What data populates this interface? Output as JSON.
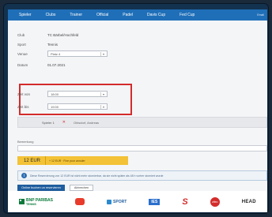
{
  "nav": {
    "tabs": [
      "Spieler",
      "Clubs",
      "Trainer",
      "Official",
      "Padel",
      "Davis Cup",
      "Fed Cup"
    ],
    "right_text": "Email"
  },
  "form": {
    "club": {
      "label": "Club",
      "value": "TC Bärbel/Hochfeld"
    },
    "sport": {
      "label": "Sport",
      "value": "Tennis"
    },
    "venue": {
      "label": "Venue",
      "value": "Platz 4"
    },
    "date": {
      "label": "Datum",
      "value": "01.07.2021"
    },
    "time_from": {
      "label": "Zeit von",
      "value": "18:00"
    },
    "time_to": {
      "label": "Zeit bis",
      "value": "19:00"
    },
    "player": {
      "label": "Spieler 1",
      "name": "Ohlsdorf, Andreas"
    },
    "note_label": "Bemerkung",
    "note_value": ""
  },
  "price": {
    "amount": "12 EUR",
    "note": "+ 12 EUR · Fixe pour annuler"
  },
  "info": {
    "text": "Diese Reservierung von 12 EUR ist nicht mehr stornierbar, da sie nicht später als 48 h vorher storniert wurde"
  },
  "buttons": {
    "primary": "Online buchen un reservieren",
    "secondary": "Abbrechen"
  },
  "sponsors": {
    "bnp": "BNP PARIBAS",
    "bnp_sub": "TENNIS",
    "sport": "SPORT",
    "ies": "IES",
    "s": "S",
    "red": "zitro",
    "head": "HEAD"
  }
}
